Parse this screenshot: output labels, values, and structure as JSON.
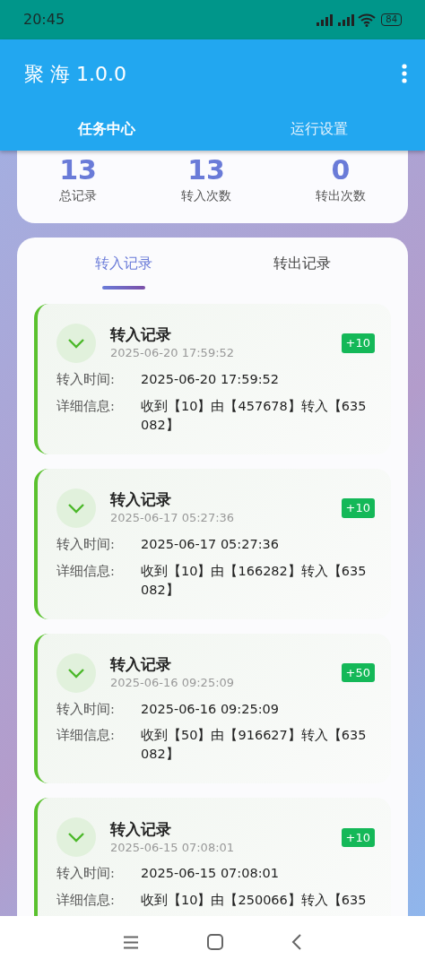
{
  "status_bar": {
    "time": "20:45",
    "battery": "84"
  },
  "app_bar": {
    "title": "聚 海 1.0.0"
  },
  "main_tabs": [
    {
      "label": "任务中心",
      "selected": true
    },
    {
      "label": "运行设置",
      "selected": false
    }
  ],
  "stats": [
    {
      "value": "13",
      "label": "总记录"
    },
    {
      "value": "13",
      "label": "转入次数"
    },
    {
      "value": "0",
      "label": "转出次数"
    }
  ],
  "record_tabs": [
    {
      "label": "转入记录",
      "selected": true
    },
    {
      "label": "转出记录",
      "selected": false
    }
  ],
  "records": [
    {
      "title": "转入记录",
      "time": "2025-06-20 17:59:52",
      "amount": "+10",
      "fields": [
        {
          "label": "转入时间:",
          "value": "2025-06-20 17:59:52"
        },
        {
          "label": "详细信息:",
          "value": "收到【10】由【457678】转入【635 082】"
        }
      ]
    },
    {
      "title": "转入记录",
      "time": "2025-06-17 05:27:36",
      "amount": "+10",
      "fields": [
        {
          "label": "转入时间:",
          "value": "2025-06-17 05:27:36"
        },
        {
          "label": "详细信息:",
          "value": "收到【10】由【166282】转入【635 082】"
        }
      ]
    },
    {
      "title": "转入记录",
      "time": "2025-06-16 09:25:09",
      "amount": "+50",
      "fields": [
        {
          "label": "转入时间:",
          "value": "2025-06-16 09:25:09"
        },
        {
          "label": "详细信息:",
          "value": "收到【50】由【916627】转入【635 082】"
        }
      ]
    },
    {
      "title": "转入记录",
      "time": "2025-06-15 07:08:01",
      "amount": "+10",
      "fields": [
        {
          "label": "转入时间:",
          "value": "2025-06-15 07:08:01"
        },
        {
          "label": "详细信息:",
          "value": "收到【10】由【250066】转入【635"
        }
      ]
    }
  ]
}
